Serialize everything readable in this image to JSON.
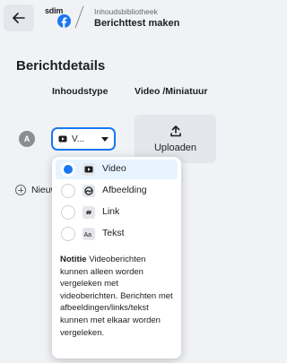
{
  "header": {
    "brand_text": "sdim",
    "breadcrumb_parent": "Inhoudsbibliotheek",
    "page_title": "Berichttest maken"
  },
  "section": {
    "title": "Berichtdetails",
    "col_type": "Inhoudstype",
    "col_media": "Video /Miniatuur"
  },
  "row": {
    "badge": "A",
    "select_value": "V...",
    "upload_label": "Uploaden"
  },
  "new_link": "Nieuw",
  "dropdown": {
    "options": [
      {
        "label": "Video",
        "icon": "video-icon",
        "selected": true
      },
      {
        "label": "Afbeelding",
        "icon": "image-icon",
        "selected": false
      },
      {
        "label": "Link",
        "icon": "link-icon",
        "selected": false
      },
      {
        "label": "Tekst",
        "icon": "text-icon",
        "selected": false
      }
    ],
    "note_title": "Notitie",
    "note_body": "Videoberichten kunnen alleen worden vergeleken met videoberichten. Berichten met afbeeldingen/links/tekst kunnen met elkaar worden vergeleken."
  },
  "colors": {
    "accent": "#1877f2",
    "background": "#f0f2f5",
    "button": "#e4e6eb"
  }
}
